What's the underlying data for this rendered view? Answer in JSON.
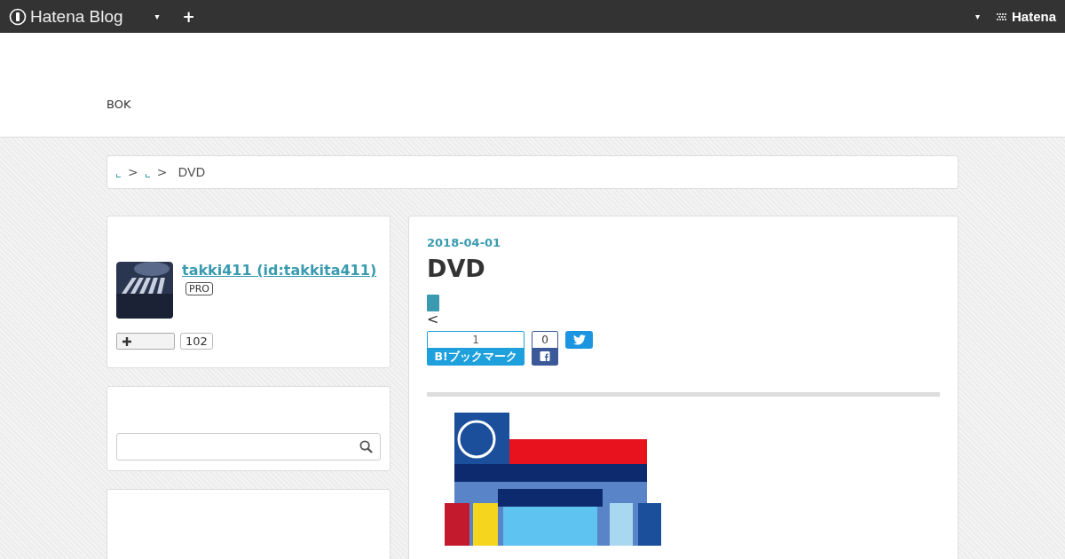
{
  "topbar": {
    "logo": "Hatena Blog",
    "menu_caret": "▾",
    "add": "+",
    "account_caret": "▾",
    "brand": "Hatena"
  },
  "header": {
    "blog_title": "BOK"
  },
  "breadcrumb": [
    {
      "kind": "link",
      "separator": ">"
    },
    {
      "kind": "link",
      "separator": ">"
    },
    {
      "kind": "current",
      "text": "DVD"
    }
  ],
  "sidebar": [
    {
      "kind": "profile",
      "name": "takki411 (id:takkita411)",
      "badge": "PRO",
      "subscribers": "102"
    },
    {
      "kind": "search"
    },
    {
      "kind": "blank"
    }
  ],
  "article": {
    "date": "2018-04-01",
    "title": "DVD",
    "back": "<",
    "bookmark": {
      "count": "1",
      "label": "B!ブックマーク"
    },
    "facebook": {
      "count": "0"
    }
  }
}
